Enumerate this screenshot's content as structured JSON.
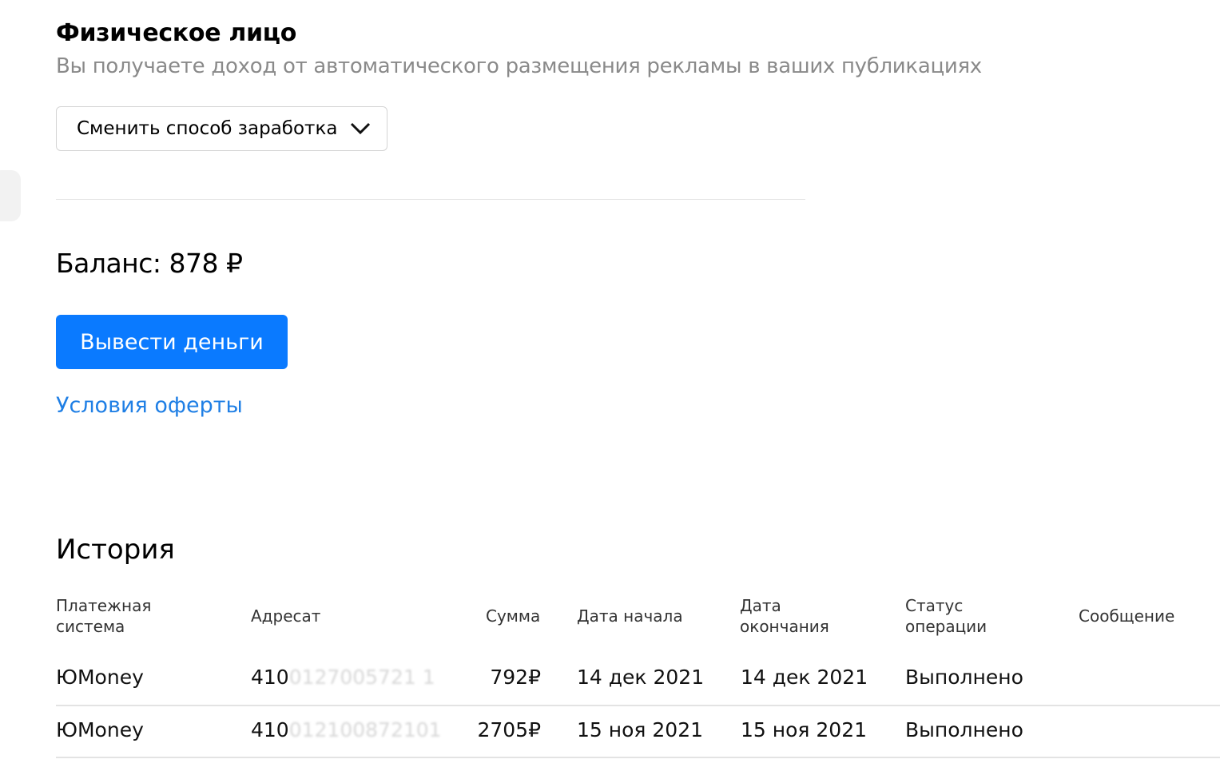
{
  "header": {
    "title": "Физическое лицо",
    "subtitle": "Вы получаете доход от автоматического размещения рекламы в ваших публикациях",
    "switch_label": "Сменить способ заработка"
  },
  "balance": {
    "label": "Баланс: 878 ₽"
  },
  "actions": {
    "withdraw_label": "Вывести деньги",
    "offer_link": "Условия оферты"
  },
  "history": {
    "title": "История",
    "columns": [
      "Платежная система",
      "Адресат",
      "Сумма",
      "Дата начала",
      "Дата окончания",
      "Статус операции",
      "Сообщение"
    ],
    "rows": [
      {
        "system": "ЮMoney",
        "address_visible": "410",
        "address_hidden": "0127005721 1",
        "amount": "792₽",
        "start": "14 дек 2021",
        "end": "14 дек 2021",
        "status": "Выполнено"
      },
      {
        "system": "ЮMoney",
        "address_visible": "410",
        "address_hidden": "012100872101",
        "amount": "2705₽",
        "start": "15 ноя 2021",
        "end": "15 ноя 2021",
        "status": "Выполнено"
      }
    ]
  },
  "colors": {
    "accent": "#0a7aff",
    "link": "#1f7fe5"
  }
}
